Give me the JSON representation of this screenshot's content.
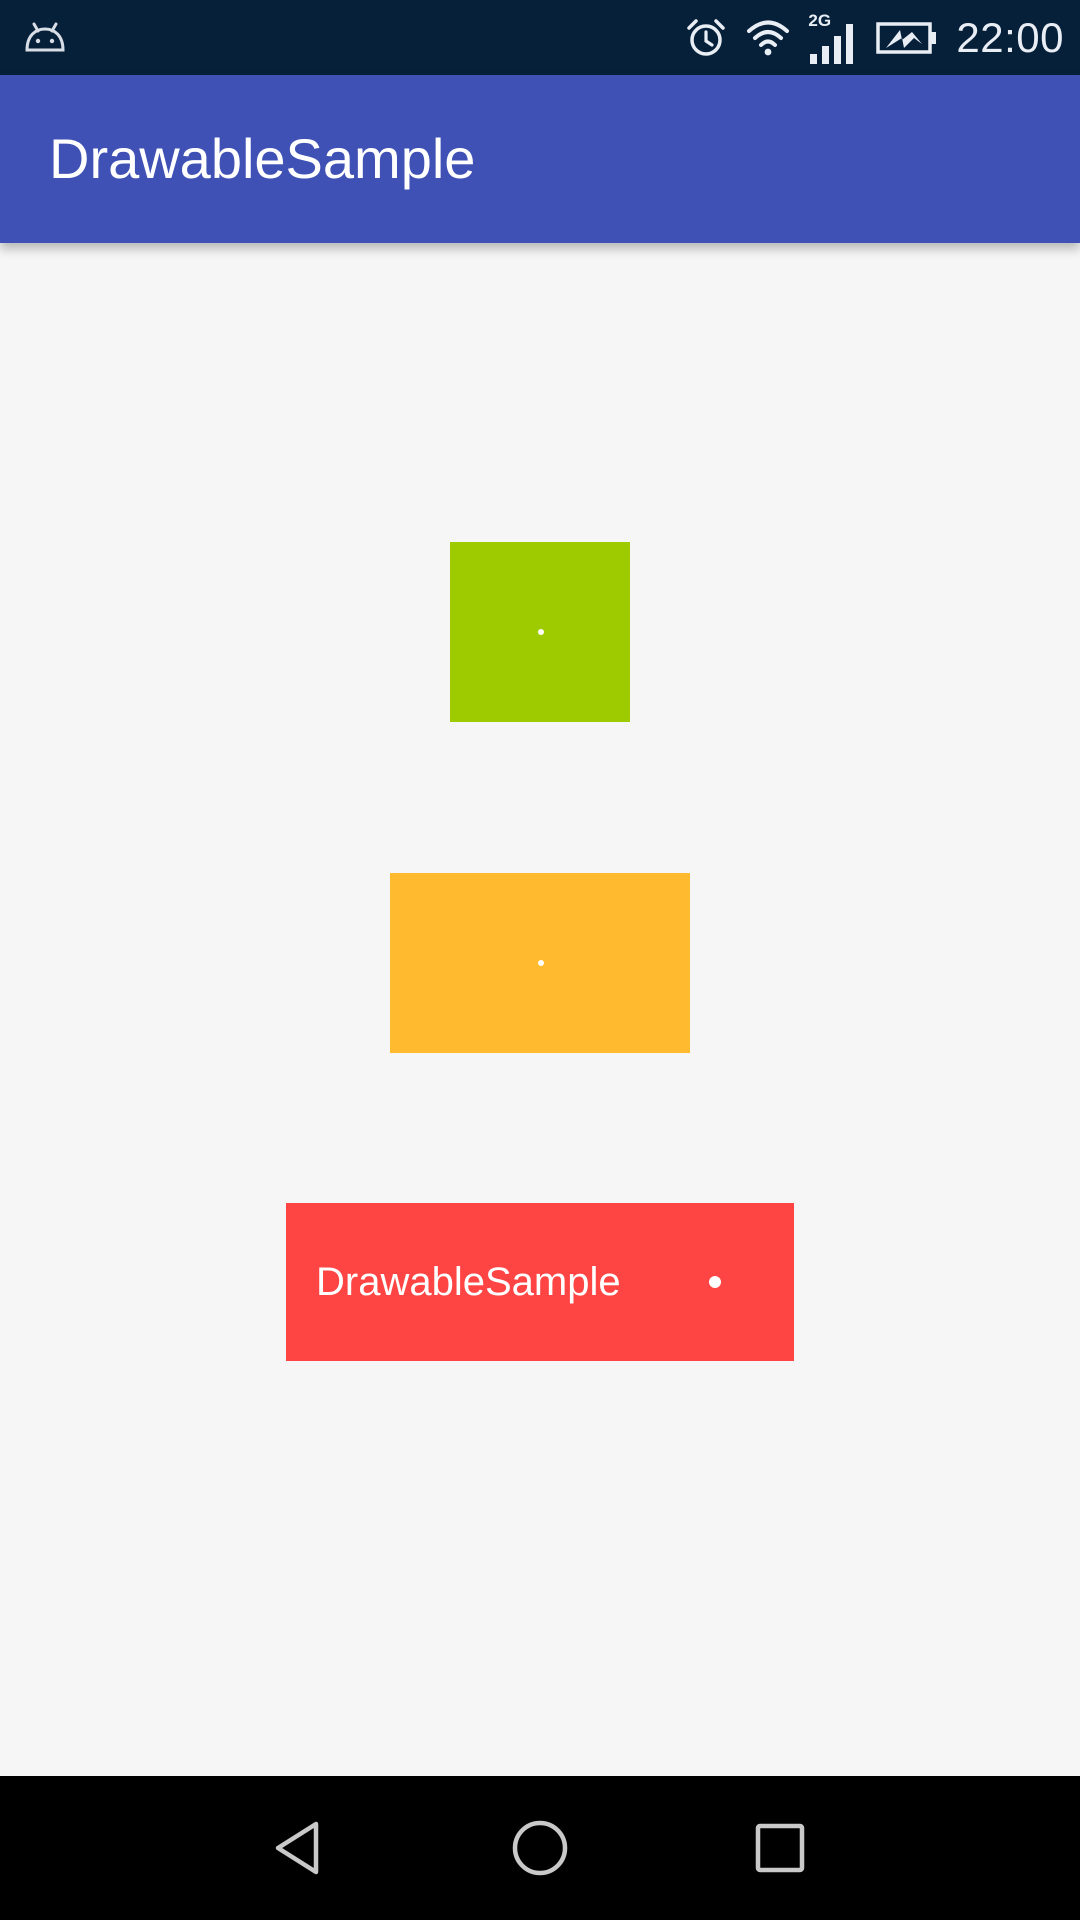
{
  "status_bar": {
    "left_icon": "android-debug-icon",
    "alarm_icon": "alarm-icon",
    "wifi_icon": "wifi-icon",
    "network_type": "2G",
    "signal_icon": "cell-signal-icon",
    "battery_icon": "battery-charging-icon",
    "time": "22:00"
  },
  "app_bar": {
    "title": "DrawableSample",
    "color": "#3f51b5"
  },
  "content": {
    "boxes": [
      {
        "name": "green",
        "color": "#9ecb00"
      },
      {
        "name": "orange",
        "color": "#ffba2f"
      },
      {
        "name": "red",
        "color": "#ff4444",
        "label": "DrawableSample"
      }
    ]
  },
  "nav_bar": {
    "back_icon": "back-icon",
    "home_icon": "home-icon",
    "recents_icon": "recents-icon"
  }
}
